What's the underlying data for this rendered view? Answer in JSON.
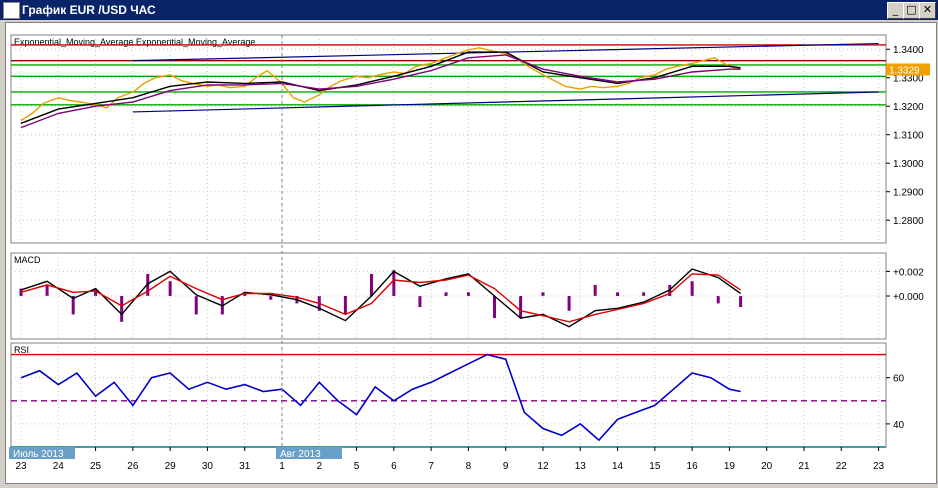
{
  "window": {
    "title": "График EUR /USD  ЧАС",
    "buttons": {
      "minimize": "_",
      "maximize": "□",
      "close": "✕"
    }
  },
  "chart_data": [
    {
      "type": "line",
      "panel": "price",
      "title": "Exponential_Moving_Average Exponential_Moving_Average",
      "ylim": [
        1.272,
        1.345
      ],
      "y_ticks": [
        "1.3400",
        "1.3300",
        "1.3200",
        "1.3100",
        "1.3000",
        "1.2900",
        "1.2800"
      ],
      "current_price": "1.3329",
      "x_ticks": [
        "23",
        "24",
        "25",
        "26",
        "29",
        "30",
        "31",
        "1",
        "2",
        "5",
        "6",
        "7",
        "8",
        "9",
        "12",
        "13",
        "14",
        "15",
        "16",
        "19",
        "20",
        "21",
        "22",
        "23"
      ],
      "month_labels": [
        "Июль 2013",
        "Авг 2013"
      ],
      "horizontal_levels": [
        {
          "y": 1.3415,
          "color": "#cc0000"
        },
        {
          "y": 1.336,
          "color": "#8b0000"
        },
        {
          "y": 1.3345,
          "color": "#00aa00"
        },
        {
          "y": 1.3305,
          "color": "#00aa00"
        },
        {
          "y": 1.325,
          "color": "#00aa00"
        },
        {
          "y": 1.3205,
          "color": "#00aa00"
        }
      ],
      "trendlines": [
        {
          "x": [
            3,
            23.0
          ],
          "y": [
            1.336,
            1.342
          ],
          "color": "#000080"
        },
        {
          "x": [
            3,
            23.0
          ],
          "y": [
            1.318,
            1.325
          ],
          "color": "#000080"
        }
      ],
      "series": [
        {
          "name": "",
          "color": "#e8a000",
          "x": [
            0,
            0.3,
            0.6,
            1,
            1.3,
            1.6,
            2,
            2.3,
            2.6,
            3,
            3.3,
            3.6,
            4,
            4.3,
            4.6,
            5,
            5.3,
            5.6,
            6,
            6.3,
            6.6,
            7,
            7.3,
            7.6,
            8,
            8.3,
            8.6,
            9,
            9.3,
            9.6,
            10,
            10.3,
            10.6,
            11,
            11.3,
            11.6,
            12,
            12.3,
            12.6,
            13,
            13.3,
            13.6,
            14,
            14.3,
            14.6,
            15,
            15.3,
            15.6,
            16,
            16.3,
            16.6,
            17,
            17.3,
            17.6,
            18,
            18.3,
            18.6,
            19,
            19.3
          ],
          "values": [
            1.315,
            1.3175,
            1.321,
            1.323,
            1.322,
            1.3215,
            1.3205,
            1.3195,
            1.323,
            1.325,
            1.328,
            1.33,
            1.331,
            1.329,
            1.328,
            1.327,
            1.3275,
            1.3265,
            1.327,
            1.33,
            1.3325,
            1.328,
            1.323,
            1.3215,
            1.324,
            1.327,
            1.329,
            1.3305,
            1.33,
            1.331,
            1.332,
            1.3315,
            1.334,
            1.335,
            1.3365,
            1.338,
            1.3398,
            1.3405,
            1.3395,
            1.3385,
            1.3365,
            1.334,
            1.331,
            1.329,
            1.327,
            1.326,
            1.327,
            1.3265,
            1.327,
            1.328,
            1.33,
            1.331,
            1.333,
            1.334,
            1.335,
            1.336,
            1.337,
            1.334,
            1.3329
          ]
        },
        {
          "name": "",
          "color": "#000000",
          "x": [
            0,
            1,
            2,
            3,
            4,
            5,
            6,
            7,
            8,
            9,
            10,
            11,
            12,
            13,
            14,
            15,
            16,
            17,
            18,
            19,
            19.3
          ],
          "values": [
            1.314,
            1.319,
            1.321,
            1.323,
            1.327,
            1.3285,
            1.328,
            1.3285,
            1.3255,
            1.3275,
            1.3305,
            1.334,
            1.339,
            1.339,
            1.332,
            1.33,
            1.328,
            1.33,
            1.334,
            1.334,
            1.3335
          ]
        },
        {
          "name": "",
          "color": "#800080",
          "x": [
            0,
            1,
            2,
            3,
            4,
            5,
            6,
            7,
            8,
            9,
            10,
            11,
            12,
            13,
            14,
            15,
            16,
            17,
            18,
            19,
            19.3
          ],
          "values": [
            1.3125,
            1.3175,
            1.32,
            1.3215,
            1.3255,
            1.3275,
            1.3275,
            1.328,
            1.326,
            1.327,
            1.3295,
            1.3325,
            1.337,
            1.338,
            1.333,
            1.3305,
            1.3285,
            1.3295,
            1.332,
            1.333,
            1.333
          ]
        }
      ]
    },
    {
      "type": "line",
      "panel": "macd",
      "title": "MACD",
      "ylim": [
        -0.0035,
        0.0035
      ],
      "y_ticks": [
        "+0.002",
        "+0.000"
      ],
      "series": [
        {
          "name": "",
          "color": "#000000",
          "x": [
            0,
            0.7,
            1.4,
            2,
            2.7,
            3.4,
            4,
            4.7,
            5.4,
            6,
            6.7,
            7.4,
            8,
            8.7,
            9.4,
            10,
            10.7,
            11.4,
            12,
            12.7,
            13.4,
            14,
            14.7,
            15.4,
            16,
            16.7,
            17.4,
            18,
            18.7,
            19.3
          ],
          "values": [
            0.0005,
            0.0012,
            -0.0002,
            0.0006,
            -0.0015,
            0.001,
            0.002,
            0.0001,
            -0.0008,
            0.0003,
            0.0001,
            -0.0003,
            -0.001,
            -0.002,
            0.0,
            0.002,
            0.0008,
            0.0014,
            0.0018,
            0.0,
            -0.0018,
            -0.0015,
            -0.0025,
            -0.0012,
            -0.001,
            -0.0005,
            0.0005,
            0.0022,
            0.0015,
            0.0002
          ]
        },
        {
          "name": "",
          "color": "#dd0000",
          "x": [
            0,
            0.7,
            1.4,
            2,
            2.7,
            3.4,
            4,
            4.7,
            5.4,
            6,
            6.7,
            7.4,
            8,
            8.7,
            9.4,
            10,
            10.7,
            11.4,
            12,
            12.7,
            13.4,
            14,
            14.7,
            15.4,
            16,
            16.7,
            17.4,
            18,
            18.7,
            19.3
          ],
          "values": [
            0.0003,
            0.0009,
            0.0003,
            0.0004,
            -0.0008,
            0.0004,
            0.0016,
            0.0006,
            -0.0003,
            0.0002,
            0.0002,
            -0.0001,
            -0.0006,
            -0.0015,
            -0.0006,
            0.0013,
            0.0011,
            0.0013,
            0.0017,
            0.0006,
            -0.0012,
            -0.0016,
            -0.0021,
            -0.0015,
            -0.0011,
            -0.0006,
            0.0002,
            0.0018,
            0.0017,
            0.0005
          ]
        }
      ]
    },
    {
      "type": "line",
      "panel": "rsi",
      "title": "RSI",
      "ylim": [
        30,
        75
      ],
      "y_ticks": [
        "60",
        "40"
      ],
      "horizontal_levels": [
        {
          "y": 70,
          "color": "#dd0000"
        },
        {
          "y": 50,
          "color": "#800080",
          "style": "dashed"
        },
        {
          "y": 30,
          "color": "#008080"
        }
      ],
      "series": [
        {
          "name": "",
          "color": "#0000cc",
          "x": [
            0,
            0.5,
            1,
            1.5,
            2,
            2.5,
            3,
            3.5,
            4,
            4.5,
            5,
            5.5,
            6,
            6.5,
            7,
            7.5,
            8,
            8.5,
            9,
            9.5,
            10,
            10.5,
            11,
            11.5,
            12,
            12.5,
            13,
            13.5,
            14,
            14.5,
            15,
            15.5,
            16,
            16.5,
            17,
            17.5,
            18,
            18.5,
            19,
            19.3
          ],
          "values": [
            60,
            63,
            57,
            62,
            52,
            58,
            48,
            60,
            62,
            55,
            58,
            55,
            57,
            54,
            55,
            48,
            58,
            50,
            44,
            56,
            50,
            55,
            58,
            62,
            66,
            70,
            68,
            45,
            38,
            35,
            40,
            33,
            42,
            45,
            48,
            55,
            62,
            60,
            55,
            54
          ]
        }
      ]
    }
  ]
}
